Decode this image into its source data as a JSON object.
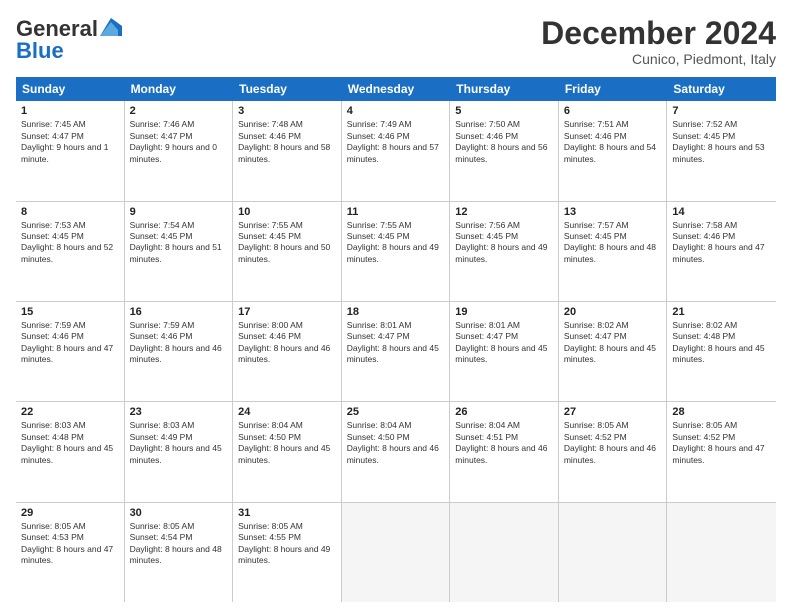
{
  "header": {
    "logo_general": "General",
    "logo_blue": "Blue",
    "month_title": "December 2024",
    "subtitle": "Cunico, Piedmont, Italy"
  },
  "weekdays": [
    "Sunday",
    "Monday",
    "Tuesday",
    "Wednesday",
    "Thursday",
    "Friday",
    "Saturday"
  ],
  "rows": [
    [
      {
        "day": "1",
        "sunrise": "Sunrise: 7:45 AM",
        "sunset": "Sunset: 4:47 PM",
        "daylight": "Daylight: 9 hours and 1 minute."
      },
      {
        "day": "2",
        "sunrise": "Sunrise: 7:46 AM",
        "sunset": "Sunset: 4:47 PM",
        "daylight": "Daylight: 9 hours and 0 minutes."
      },
      {
        "day": "3",
        "sunrise": "Sunrise: 7:48 AM",
        "sunset": "Sunset: 4:46 PM",
        "daylight": "Daylight: 8 hours and 58 minutes."
      },
      {
        "day": "4",
        "sunrise": "Sunrise: 7:49 AM",
        "sunset": "Sunset: 4:46 PM",
        "daylight": "Daylight: 8 hours and 57 minutes."
      },
      {
        "day": "5",
        "sunrise": "Sunrise: 7:50 AM",
        "sunset": "Sunset: 4:46 PM",
        "daylight": "Daylight: 8 hours and 56 minutes."
      },
      {
        "day": "6",
        "sunrise": "Sunrise: 7:51 AM",
        "sunset": "Sunset: 4:46 PM",
        "daylight": "Daylight: 8 hours and 54 minutes."
      },
      {
        "day": "7",
        "sunrise": "Sunrise: 7:52 AM",
        "sunset": "Sunset: 4:45 PM",
        "daylight": "Daylight: 8 hours and 53 minutes."
      }
    ],
    [
      {
        "day": "8",
        "sunrise": "Sunrise: 7:53 AM",
        "sunset": "Sunset: 4:45 PM",
        "daylight": "Daylight: 8 hours and 52 minutes."
      },
      {
        "day": "9",
        "sunrise": "Sunrise: 7:54 AM",
        "sunset": "Sunset: 4:45 PM",
        "daylight": "Daylight: 8 hours and 51 minutes."
      },
      {
        "day": "10",
        "sunrise": "Sunrise: 7:55 AM",
        "sunset": "Sunset: 4:45 PM",
        "daylight": "Daylight: 8 hours and 50 minutes."
      },
      {
        "day": "11",
        "sunrise": "Sunrise: 7:55 AM",
        "sunset": "Sunset: 4:45 PM",
        "daylight": "Daylight: 8 hours and 49 minutes."
      },
      {
        "day": "12",
        "sunrise": "Sunrise: 7:56 AM",
        "sunset": "Sunset: 4:45 PM",
        "daylight": "Daylight: 8 hours and 49 minutes."
      },
      {
        "day": "13",
        "sunrise": "Sunrise: 7:57 AM",
        "sunset": "Sunset: 4:45 PM",
        "daylight": "Daylight: 8 hours and 48 minutes."
      },
      {
        "day": "14",
        "sunrise": "Sunrise: 7:58 AM",
        "sunset": "Sunset: 4:46 PM",
        "daylight": "Daylight: 8 hours and 47 minutes."
      }
    ],
    [
      {
        "day": "15",
        "sunrise": "Sunrise: 7:59 AM",
        "sunset": "Sunset: 4:46 PM",
        "daylight": "Daylight: 8 hours and 47 minutes."
      },
      {
        "day": "16",
        "sunrise": "Sunrise: 7:59 AM",
        "sunset": "Sunset: 4:46 PM",
        "daylight": "Daylight: 8 hours and 46 minutes."
      },
      {
        "day": "17",
        "sunrise": "Sunrise: 8:00 AM",
        "sunset": "Sunset: 4:46 PM",
        "daylight": "Daylight: 8 hours and 46 minutes."
      },
      {
        "day": "18",
        "sunrise": "Sunrise: 8:01 AM",
        "sunset": "Sunset: 4:47 PM",
        "daylight": "Daylight: 8 hours and 45 minutes."
      },
      {
        "day": "19",
        "sunrise": "Sunrise: 8:01 AM",
        "sunset": "Sunset: 4:47 PM",
        "daylight": "Daylight: 8 hours and 45 minutes."
      },
      {
        "day": "20",
        "sunrise": "Sunrise: 8:02 AM",
        "sunset": "Sunset: 4:47 PM",
        "daylight": "Daylight: 8 hours and 45 minutes."
      },
      {
        "day": "21",
        "sunrise": "Sunrise: 8:02 AM",
        "sunset": "Sunset: 4:48 PM",
        "daylight": "Daylight: 8 hours and 45 minutes."
      }
    ],
    [
      {
        "day": "22",
        "sunrise": "Sunrise: 8:03 AM",
        "sunset": "Sunset: 4:48 PM",
        "daylight": "Daylight: 8 hours and 45 minutes."
      },
      {
        "day": "23",
        "sunrise": "Sunrise: 8:03 AM",
        "sunset": "Sunset: 4:49 PM",
        "daylight": "Daylight: 8 hours and 45 minutes."
      },
      {
        "day": "24",
        "sunrise": "Sunrise: 8:04 AM",
        "sunset": "Sunset: 4:50 PM",
        "daylight": "Daylight: 8 hours and 45 minutes."
      },
      {
        "day": "25",
        "sunrise": "Sunrise: 8:04 AM",
        "sunset": "Sunset: 4:50 PM",
        "daylight": "Daylight: 8 hours and 46 minutes."
      },
      {
        "day": "26",
        "sunrise": "Sunrise: 8:04 AM",
        "sunset": "Sunset: 4:51 PM",
        "daylight": "Daylight: 8 hours and 46 minutes."
      },
      {
        "day": "27",
        "sunrise": "Sunrise: 8:05 AM",
        "sunset": "Sunset: 4:52 PM",
        "daylight": "Daylight: 8 hours and 46 minutes."
      },
      {
        "day": "28",
        "sunrise": "Sunrise: 8:05 AM",
        "sunset": "Sunset: 4:52 PM",
        "daylight": "Daylight: 8 hours and 47 minutes."
      }
    ],
    [
      {
        "day": "29",
        "sunrise": "Sunrise: 8:05 AM",
        "sunset": "Sunset: 4:53 PM",
        "daylight": "Daylight: 8 hours and 47 minutes."
      },
      {
        "day": "30",
        "sunrise": "Sunrise: 8:05 AM",
        "sunset": "Sunset: 4:54 PM",
        "daylight": "Daylight: 8 hours and 48 minutes."
      },
      {
        "day": "31",
        "sunrise": "Sunrise: 8:05 AM",
        "sunset": "Sunset: 4:55 PM",
        "daylight": "Daylight: 8 hours and 49 minutes."
      },
      null,
      null,
      null,
      null
    ]
  ]
}
